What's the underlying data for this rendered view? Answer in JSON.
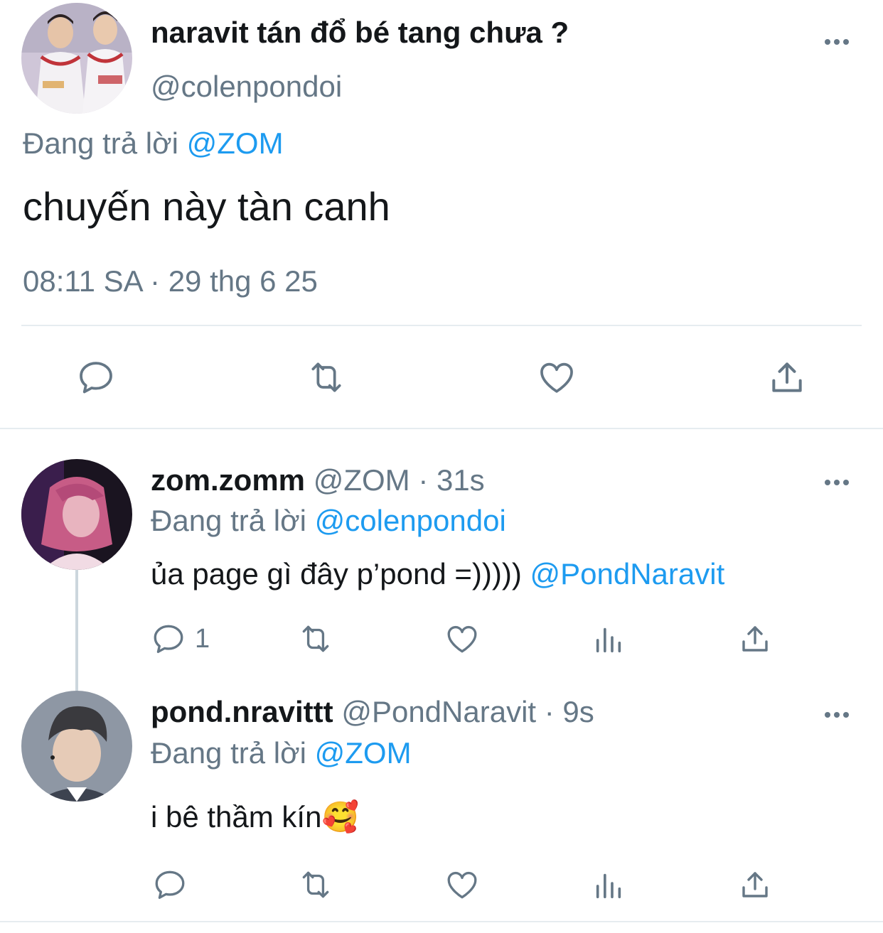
{
  "main_tweet": {
    "author_name": "naravit tán đổ bé tang chưa ?",
    "handle": "@colenpondoi",
    "reply_prefix": "Đang trả lời",
    "reply_to": "@ZOM",
    "text": "chuyến này tàn canh",
    "timestamp": "08:11 SA · 29 thg 6 25"
  },
  "action_bar": {
    "icons": [
      "reply-icon",
      "retweet-icon",
      "like-icon",
      "share-icon"
    ]
  },
  "replies": [
    {
      "author_name": "zom.zomm",
      "handle": "@ZOM",
      "time": "· 31s",
      "reply_prefix": "Đang trả lời",
      "reply_to": "@colenpondoi",
      "text": "ủa page gì đây p’pond =)))))",
      "mention": "@PondNaravit",
      "reply_count": "1"
    },
    {
      "author_name": "pond.nravittt",
      "handle": "@PondNaravit",
      "time": "· 9s",
      "reply_prefix": "Đang trả lời",
      "reply_to": "@ZOM",
      "text": "i bê thầm kín",
      "emoji": "🥰"
    }
  ],
  "colors": {
    "text": "#14171a",
    "secondary": "#657786",
    "link": "#1d9bf0",
    "divider": "#e6ecf0"
  }
}
